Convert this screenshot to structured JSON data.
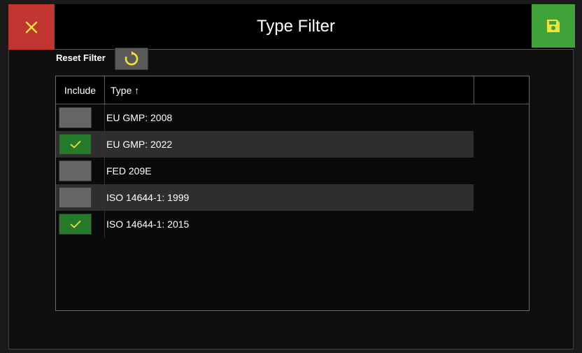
{
  "header": {
    "title": "Type Filter",
    "close_icon": "close-icon",
    "save_icon": "save-icon"
  },
  "colors": {
    "close": "#c0352f",
    "save": "#3fa33a",
    "check": "#e8e23a",
    "checked_bg": "#247a29",
    "unchecked_bg": "#666666"
  },
  "filter": {
    "reset_label": "Reset Filter",
    "reset_icon": "reset-icon"
  },
  "table": {
    "columns": {
      "include": "Include",
      "type": "Type ↑"
    },
    "rows": [
      {
        "type": "EU GMP: 2008",
        "included": false
      },
      {
        "type": "EU GMP: 2022",
        "included": true
      },
      {
        "type": "FED 209E",
        "included": false
      },
      {
        "type": "ISO 14644-1: 1999",
        "included": false
      },
      {
        "type": "ISO 14644-1: 2015",
        "included": true
      }
    ]
  }
}
